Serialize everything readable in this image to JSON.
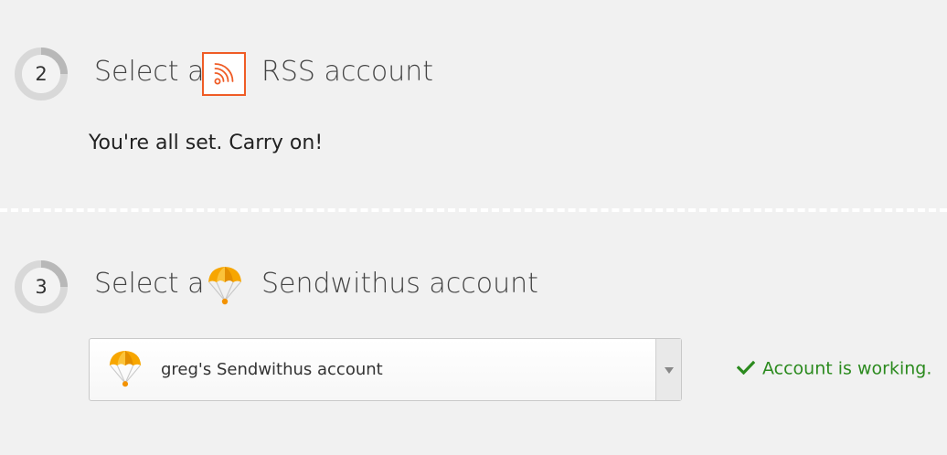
{
  "step2": {
    "number": "2",
    "title_prefix": "Select a",
    "title_suffix": "RSS account",
    "status": "You're all set. Carry on!"
  },
  "step3": {
    "number": "3",
    "title_prefix": "Select a",
    "title_suffix": "Sendwithus account",
    "selected_account": "greg's Sendwithus account",
    "account_status": "Account is working."
  },
  "colors": {
    "rss_brand": "#ef5c26",
    "sendwithus_brand": "#f7a600",
    "success": "#2b8a1e"
  },
  "icons": {
    "rss": "rss-icon",
    "sendwithus": "parachute-icon",
    "success": "checkmark-icon",
    "dropdown": "chevron-down-icon"
  }
}
